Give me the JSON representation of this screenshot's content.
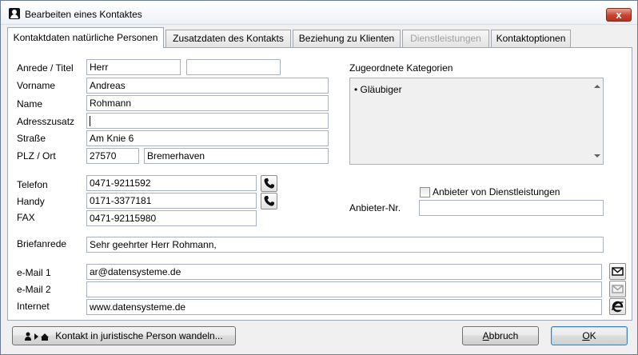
{
  "window": {
    "title": "Bearbeiten eines Kontaktes",
    "close_glyph": "x"
  },
  "tabs": [
    {
      "label": "Kontaktdaten natürliche Personen",
      "state": "active"
    },
    {
      "label": "Zusatzdaten des Kontakts",
      "state": "normal"
    },
    {
      "label": "Beziehung zu Klienten",
      "state": "normal"
    },
    {
      "label": "Dienstleistungen",
      "state": "disabled"
    },
    {
      "label": "Kontaktoptionen",
      "state": "normal"
    }
  ],
  "form": {
    "anrede_label": "Anrede / Titel",
    "anrede_value": "Herr",
    "titel_value": "",
    "vorname_label": "Vorname",
    "vorname_value": "Andreas",
    "name_label": "Name",
    "name_value": "Rohmann",
    "adresszusatz_label": "Adresszusatz",
    "adresszusatz_value": "",
    "strasse_label": "Straße",
    "strasse_value": "Am Knie 6",
    "plzort_label": "PLZ / Ort",
    "plz_value": "27570",
    "ort_value": "Bremerhaven",
    "telefon_label": "Telefon",
    "telefon_value": "0471-9211592",
    "handy_label": "Handy",
    "handy_value": "0171-3377181",
    "fax_label": "FAX",
    "fax_value": "0471-92115980",
    "briefanrede_label": "Briefanrede",
    "briefanrede_value": "Sehr geehrter Herr Rohmann,",
    "email1_label": "e-Mail 1",
    "email1_value": "ar@datensysteme.de",
    "email2_label": "e-Mail 2",
    "email2_value": "",
    "internet_label": "Internet",
    "internet_value": "www.datensysteme.de"
  },
  "categories": {
    "label": "Zugeordnete Kategorien",
    "items": [
      "• Gläubiger"
    ]
  },
  "anbieter": {
    "checkbox_label": "Anbieter von Dienstleistungen",
    "checked": false,
    "nr_label": "Anbieter-Nr.",
    "nr_value": ""
  },
  "footer": {
    "convert_label": "Kontakt in juristische Person wandeln...",
    "cancel_label_underlined": "A",
    "cancel_label_rest": "bbruch",
    "ok_label_underlined": "O",
    "ok_label_rest": "K"
  },
  "icons": {
    "title": "contact-person-icon",
    "telefon_call": "phone-icon",
    "handy_call": "phone-icon",
    "email1_send": "mail-icon",
    "email2_send": "mail-disabled-icon",
    "internet_open": "internet-explorer-icon",
    "convert": "person-to-company-icon"
  },
  "colors": {
    "close_button": "#c7432f",
    "disabled_text": "#a0a0a0",
    "panel_background": "#ffffff"
  }
}
